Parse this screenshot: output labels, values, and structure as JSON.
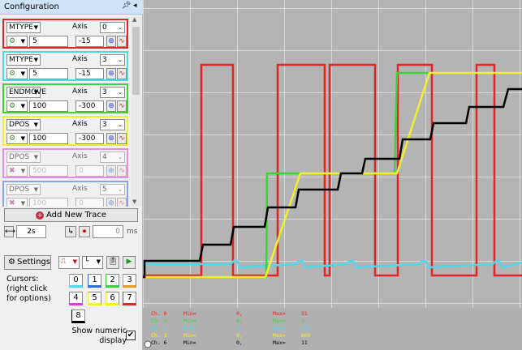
{
  "panel": {
    "title": "Configuration",
    "pin_icon": "pin-icon",
    "dropdown_icon": "panel-menu-icon"
  },
  "traces": [
    {
      "color": "#e32424",
      "param": "MTYPE",
      "axis_label": "Axis",
      "axis": "0",
      "value": "5",
      "offset": "-15",
      "enabled": true,
      "param_active": true
    },
    {
      "color": "#4dd9ea",
      "param": "MTYPE",
      "axis_label": "Axis",
      "axis": "3",
      "value": "5",
      "offset": "-15",
      "enabled": true,
      "param_active": false
    },
    {
      "color": "#3ad43a",
      "param": "ENDMOVE",
      "axis_label": "Axis",
      "axis": "3",
      "value": "100",
      "offset": "-300",
      "enabled": true,
      "param_active": true
    },
    {
      "color": "#f4ef2e",
      "param": "DPOS",
      "axis_label": "Axis",
      "axis": "3",
      "value": "100",
      "offset": "-300",
      "enabled": true,
      "param_active": true
    },
    {
      "color": "#e03ae0",
      "param": "DPOS",
      "axis_label": "Axis",
      "axis": "4",
      "value": "500",
      "offset": "0",
      "enabled": false,
      "param_active": false
    },
    {
      "color": "#2d6fe0",
      "param": "DPOS",
      "axis_label": "Axis",
      "axis": "5",
      "value": "100",
      "offset": "0",
      "enabled": false,
      "param_active": false
    }
  ],
  "add_trace_label": "Add New Trace",
  "timebase": {
    "value": "2s",
    "delay_value": "0",
    "delay_unit": "ms"
  },
  "settings_label": "Settings",
  "cursors_label": "Cursors:\n(right click\nfor options)",
  "cursors": [
    {
      "label": "0",
      "color": "#4dd9ea"
    },
    {
      "label": "1",
      "color": "#2d6fe0"
    },
    {
      "label": "2",
      "color": "#3ad43a"
    },
    {
      "label": "3",
      "color": "#e39a24"
    },
    {
      "label": "4",
      "color": "#e03ae0"
    },
    {
      "label": "5",
      "color": "#f4ef2e"
    },
    {
      "label": "6",
      "color": "#f4ef2e"
    },
    {
      "label": "7",
      "color": "#e32424"
    },
    {
      "label": "8",
      "color": "#000000"
    }
  ],
  "numeric_label": "Show numeric display",
  "numeric_checked": true,
  "plot": {
    "bg": "#b4b4b4",
    "grid": "#d8d8d8",
    "stats": [
      {
        "ch": "Ch. 0",
        "min_label": "Min=",
        "min": "0,",
        "max_label": "Max=",
        "max": "31",
        "color": "#e32424"
      },
      {
        "ch": "Ch. 2",
        "min_label": "Min=",
        "min": "0,",
        "max_label": "Max=",
        "max": "1",
        "color": "#3ad43a"
      },
      {
        "ch": "Ch. 1",
        "min_label": "Min=",
        "min": "0,",
        "max_label": "Max=",
        "max": "600",
        "color": "#4dd9ea"
      },
      {
        "ch": "Ch. 3",
        "min_label": "Min=",
        "min": "0,",
        "max_label": "Max=",
        "max": "600",
        "color": "#f4ef2e"
      },
      {
        "ch": "Ch. 6",
        "min_label": "Min=",
        "min": "0,",
        "max_label": "Max=",
        "max": "11",
        "color": "#000000"
      }
    ]
  }
}
